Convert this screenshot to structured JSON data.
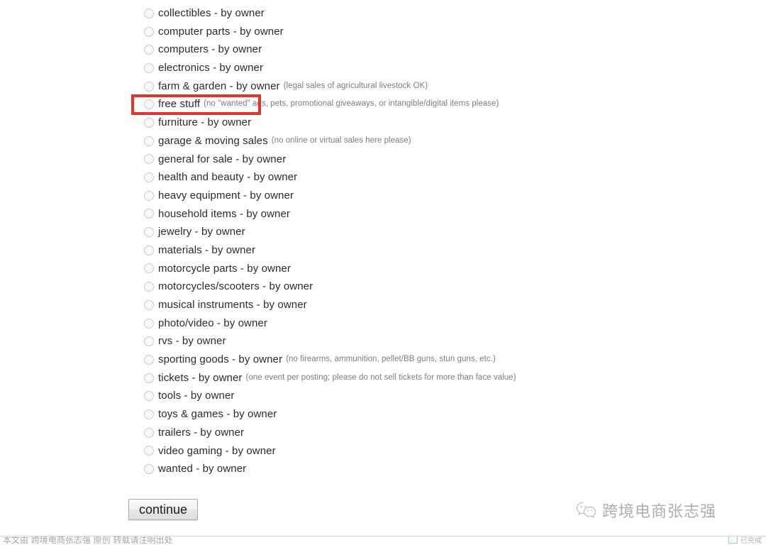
{
  "page": {
    "background_color": "#ffffff",
    "text_color": "#2b2b2b",
    "note_color": "#7d7d7d"
  },
  "categories": [
    {
      "label": "collectibles - by owner",
      "note": ""
    },
    {
      "label": "computer parts - by owner",
      "note": ""
    },
    {
      "label": "computers - by owner",
      "note": ""
    },
    {
      "label": "electronics - by owner",
      "note": ""
    },
    {
      "label": "farm & garden - by owner",
      "note": "(legal sales of agricultural livestock OK)"
    },
    {
      "label": "free stuff",
      "note": "(no \"wanted\" ads, pets, promotional giveaways, or intangible/digital items please)"
    },
    {
      "label": "furniture - by owner",
      "note": ""
    },
    {
      "label": "garage & moving sales",
      "note": "(no online or virtual sales here please)"
    },
    {
      "label": "general for sale - by owner",
      "note": ""
    },
    {
      "label": "health and beauty - by owner",
      "note": ""
    },
    {
      "label": "heavy equipment - by owner",
      "note": ""
    },
    {
      "label": "household items - by owner",
      "note": ""
    },
    {
      "label": "jewelry - by owner",
      "note": ""
    },
    {
      "label": "materials - by owner",
      "note": ""
    },
    {
      "label": "motorcycle parts - by owner",
      "note": ""
    },
    {
      "label": "motorcycles/scooters - by owner",
      "note": ""
    },
    {
      "label": "musical instruments - by owner",
      "note": ""
    },
    {
      "label": "photo/video - by owner",
      "note": ""
    },
    {
      "label": "rvs - by owner",
      "note": ""
    },
    {
      "label": "sporting goods - by owner",
      "note": "(no firearms, ammunition, pellet/BB guns, stun guns, etc.)"
    },
    {
      "label": "tickets - by owner",
      "note": "(one event per posting; please do not sell tickets for more than face value)"
    },
    {
      "label": "tools - by owner",
      "note": ""
    },
    {
      "label": "toys & games - by owner",
      "note": ""
    },
    {
      "label": "trailers - by owner",
      "note": ""
    },
    {
      "label": "video gaming - by owner",
      "note": ""
    },
    {
      "label": "wanted - by owner",
      "note": ""
    }
  ],
  "highlight": {
    "target_label": "free stuff",
    "color": "#e8312a",
    "shape": "rectangle-outline"
  },
  "actions": {
    "continue_label": "continue"
  },
  "watermark": {
    "icon": "wechat-icon",
    "text": "跨境电商张志强",
    "color": "#3c3c3c"
  },
  "bottom_bar": {
    "clipped_text": "本文由 跨境电商张志强 原创 转载请注明出处",
    "marker_text": "已完成"
  }
}
